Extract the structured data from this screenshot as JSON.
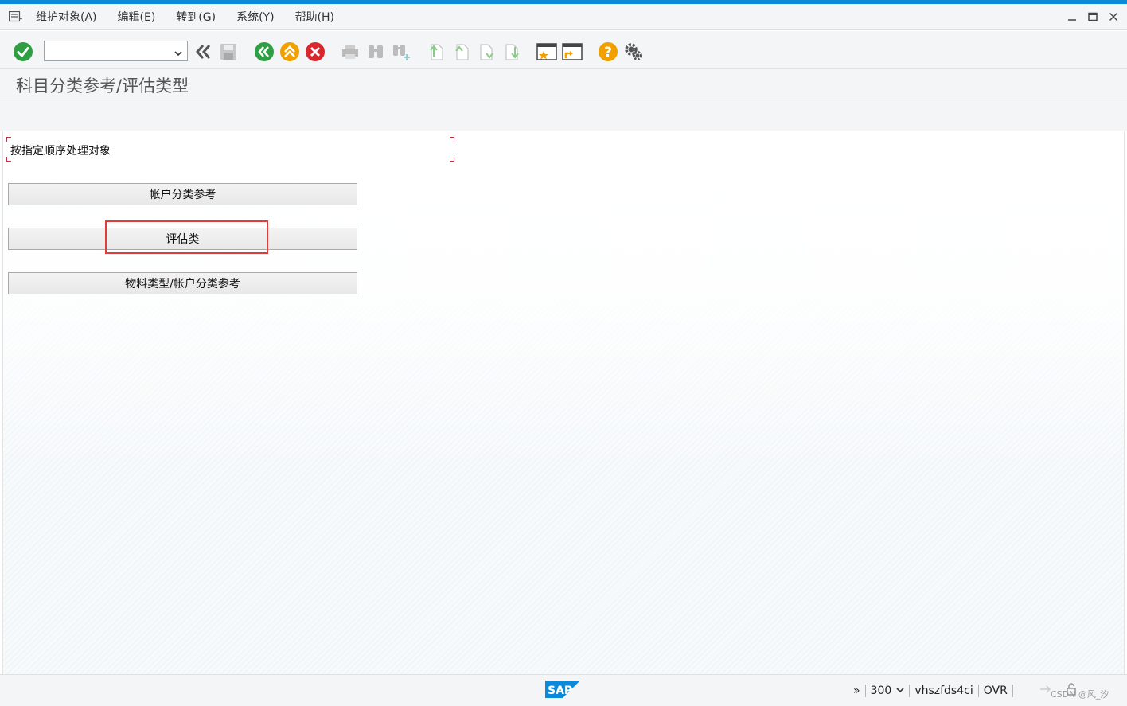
{
  "menu": {
    "items": [
      "维护对象(A)",
      "编辑(E)",
      "转到(G)",
      "系统(Y)",
      "帮助(H)"
    ]
  },
  "toolbar": {
    "command_value": "",
    "icons": [
      "enter-icon",
      "command-field",
      "collapse-icon",
      "save-icon",
      "back-icon",
      "exit-icon",
      "cancel-icon",
      "print-icon",
      "find-icon",
      "find-next-icon",
      "first-page-icon",
      "previous-page-icon",
      "next-page-icon",
      "last-page-icon",
      "create-session-icon",
      "shortcut-icon",
      "help-icon",
      "settings-icon"
    ]
  },
  "header": {
    "title": "科目分类参考/评估类型"
  },
  "main": {
    "group_label": "按指定顺序处理对象",
    "buttons": [
      "帐户分类参考",
      "评估类",
      "物料类型/帐户分类参考"
    ]
  },
  "status": {
    "arrows": "»",
    "client": "300",
    "server": "vhszfds4ci",
    "mode": "OVR",
    "watermark": "CSDN @风_汐"
  },
  "colors": {
    "accent": "#0a8ad8",
    "enter_green": "#2ea043",
    "exit_orange": "#f0a000",
    "cancel_red": "#d9272e",
    "help_orange": "#f0a000",
    "highlight_red": "#e23b3b"
  }
}
